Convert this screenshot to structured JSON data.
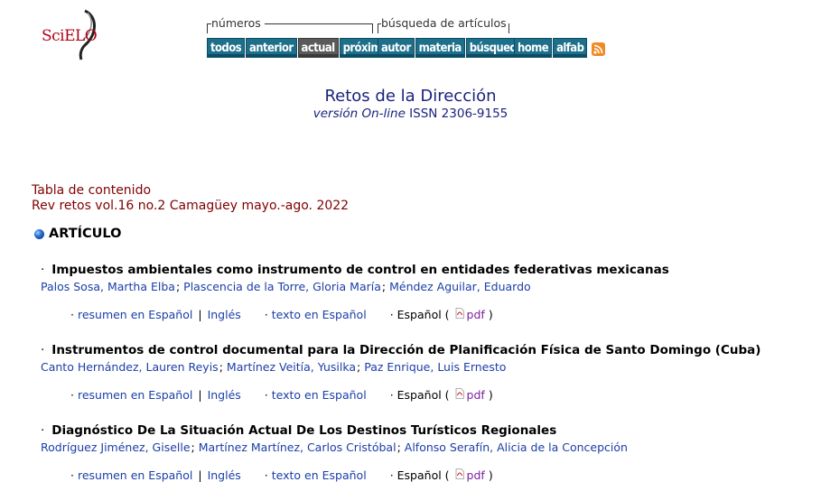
{
  "logo": {
    "text": "SciELO"
  },
  "nav": {
    "numeros_label": "números",
    "busqueda_label": "búsqueda de artículos",
    "buttons": [
      "todos",
      "anterior",
      "actual",
      "próximo",
      "autor",
      "materia",
      "búsqueda",
      "home",
      "alfab"
    ],
    "active": "actual",
    "accent": "#1d6f8a"
  },
  "journal": {
    "title": "Retos de la Dirección",
    "version": "versión On-line",
    "issn": "ISSN 2306-9155"
  },
  "toc": {
    "heading": "Tabla de contenido",
    "issue": "Rev retos vol.16 no.2 Camagüey mayo.-ago. 2022"
  },
  "section": {
    "title": "ARTÍCULO"
  },
  "articles": [
    {
      "title": "Impuestos ambientales como instrumento de control en entidades federativas mexicanas",
      "authors": [
        "Palos Sosa, Martha Elba",
        "Plascencia de la Torre, Gloria María",
        "Méndez Aguilar, Eduardo"
      ]
    },
    {
      "title": "Instrumentos de control documental para la Dirección de Planificación Física de Santo Domingo (Cuba)",
      "authors": [
        "Canto Hernández, Lauren Reyis",
        "Martínez Veitía, Yusilka",
        "Paz Enrique, Luis Ernesto"
      ]
    },
    {
      "title": "Diagnóstico De La Situación Actual De Los Destinos Turísticos Regionales",
      "authors": [
        "Rodríguez Jiménez, Giselle",
        "Martínez Martínez, Carlos Cristóbal",
        "Alfonso Serafín, Alicia de la Concepción"
      ]
    }
  ],
  "links": {
    "resumen": "resumen en Español",
    "ingles": "Inglés",
    "texto": "texto en Español",
    "espanol": "Español (",
    "pdf": "pdf",
    "close": ")"
  }
}
